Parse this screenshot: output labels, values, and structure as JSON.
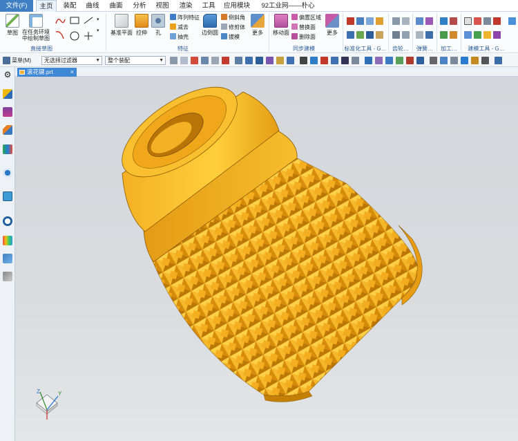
{
  "menu": {
    "tabs": [
      "文件(F)",
      "主页",
      "装配",
      "曲线",
      "曲面",
      "分析",
      "视图",
      "渲染",
      "工具",
      "应用模块",
      "92工业网——朴心"
    ],
    "active": "主页"
  },
  "ribbon": {
    "sketch_group": {
      "label": "直接草图",
      "sketch": "草图",
      "task_sketch": "在任务环境中绘制草图"
    },
    "feature_group": {
      "label": "特征",
      "datum_plane": "基准平面",
      "extrude": "拉伸",
      "hole": "孔",
      "pattern_feature": "阵列特征",
      "subtract": "减去",
      "extract": "抽壳",
      "edge_blend": "边倒圆",
      "chamfer": "倒斜角",
      "trim_body": "修剪体",
      "draft": "拔模",
      "more": "更多"
    },
    "sync_group": {
      "label": "同步建模",
      "move_face": "移动面",
      "offset_region": "偏置区域",
      "replace_face": "替换面",
      "delete_face": "删除面",
      "more": "更多"
    },
    "std_label": "标准化工具 - G…",
    "gear_label": "齿轮…",
    "spring_label": "弹簧…",
    "machining_label": "加工…",
    "modeling_tools_label": "建模工具 - G…"
  },
  "selbar": {
    "menu_label": "菜单(M)",
    "filter_value": "无选择过滤器",
    "scope_value": "整个装配"
  },
  "document": {
    "tab_label": "滚花键.prt"
  },
  "triad": {
    "x": "X",
    "y": "Y",
    "z": "Z"
  },
  "colors": {
    "part_light": "#fcc22a",
    "part_mid": "#f0a814",
    "part_dark": "#c07d05",
    "file_tab": "#3d7fc2",
    "doc_tab": "#3e88d6",
    "background": "#d7dadd"
  }
}
